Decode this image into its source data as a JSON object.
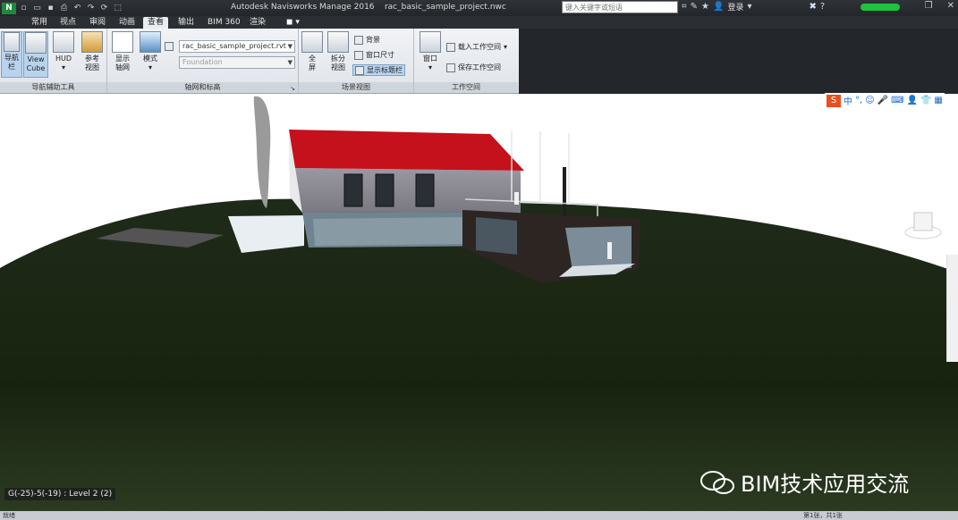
{
  "titlebar": {
    "title": "Autodesk Navisworks Manage 2016",
    "file": "rac_basic_sample_project.nwc",
    "search_placeholder": "键入关键字或短语",
    "login": "登录"
  },
  "menu": {
    "tabs": [
      "常用",
      "视点",
      "审阅",
      "动画",
      "查看",
      "输出",
      "BIM 360",
      "渲染"
    ],
    "active": "查看"
  },
  "ribbon": {
    "nav_group": {
      "title": "导航辅助工具",
      "buttons": [
        {
          "label": "导航\n栏"
        },
        {
          "label": "View\nCube"
        },
        {
          "label": "HUD"
        },
        {
          "label": "参考\n视图"
        }
      ]
    },
    "grid_group": {
      "title": "轴网和标高",
      "show_grid": "显示\n轴网",
      "mode": "模式",
      "file_combo": "rac_basic_sample_project.rvt",
      "level_combo": "Foundation"
    },
    "scene_group": {
      "title": "场景视图",
      "fullscreen": "全\n屏",
      "split": "拆分\n视图",
      "background": "背景",
      "window_size": "窗口尺寸",
      "show_title": "显示标题栏"
    },
    "workspace_group": {
      "title": "工作空间",
      "window": "窗口",
      "load": "载入工作空间",
      "save": "保存工作空间"
    }
  },
  "viewport": {
    "coord_readout": "G(-25)-5(-19) : Level 2 (2)",
    "watermark": "BIM技术应用交流",
    "ime": "中"
  },
  "statusbar": {
    "left": "就绪",
    "pages": "第1张，共1张"
  },
  "colors": {
    "roof": "#c4111b",
    "terrain": "#1b2a16",
    "ribbon": "#e6e9ed"
  }
}
